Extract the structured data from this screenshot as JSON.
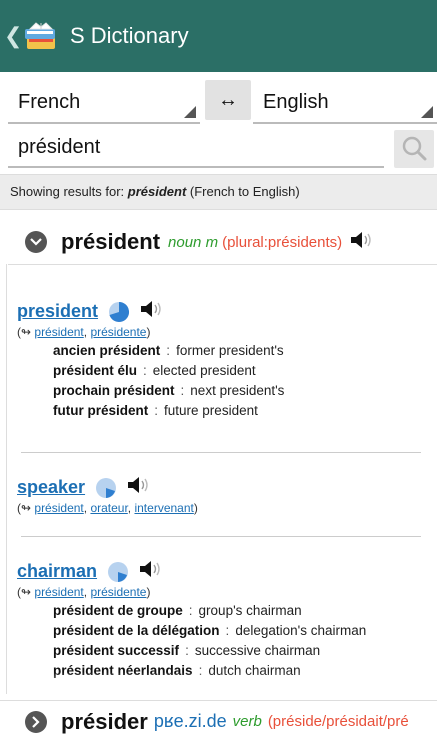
{
  "app": {
    "title": "S Dictionary",
    "back_glyph": "❮"
  },
  "languages": {
    "from": "French",
    "to": "English",
    "swap_glyph": "↔"
  },
  "search": {
    "value": "président",
    "placeholder": ""
  },
  "results_bar": {
    "prefix": "Showing results for: ",
    "term": "président",
    "suffix": " (French to English)"
  },
  "entry": {
    "headword": "président",
    "pos": "noun m",
    "plural": "(plural:présidents)",
    "translations": [
      {
        "word": "president",
        "synonyms_prefix": "(↬ ",
        "synonyms": [
          "président",
          "présidente"
        ],
        "synonyms_suffix": ")",
        "frequency": 0.6,
        "examples": [
          {
            "fr": "ancien président",
            "en": "former president's"
          },
          {
            "fr": "président élu",
            "en": "elected president"
          },
          {
            "fr": "prochain président",
            "en": "next president's"
          },
          {
            "fr": "futur président",
            "en": "future president"
          }
        ]
      },
      {
        "word": "speaker",
        "synonyms_prefix": "(↬ ",
        "synonyms": [
          "président",
          "orateur",
          "intervenant"
        ],
        "synonyms_suffix": ")",
        "frequency": 0.3,
        "examples": []
      },
      {
        "word": "chairman",
        "synonyms_prefix": "(↬ ",
        "synonyms": [
          "président",
          "présidente"
        ],
        "synonyms_suffix": ")",
        "frequency": 0.3,
        "examples": [
          {
            "fr": "président de groupe",
            "en": "group's chairman"
          },
          {
            "fr": "président de la délégation",
            "en": "delegation's chairman"
          },
          {
            "fr": "président successif",
            "en": "successive chairman"
          },
          {
            "fr": "président néerlandais",
            "en": "dutch chairman"
          }
        ]
      }
    ]
  },
  "next_entry": {
    "headword": "présider",
    "pronunciation": "pʁe.zi.de",
    "pos": "verb",
    "forms": "(préside/présidait/pré"
  },
  "colors": {
    "appbar": "#2b6f66",
    "link": "#1c6fb4",
    "pos": "#2e9c2e",
    "plural": "#e8503a",
    "freq": "#2f7fd0"
  },
  "icons": {
    "back": "chevron-left-icon",
    "logo": "book-logo-icon",
    "search": "search-icon",
    "expand": "chevron-down-icon",
    "collapsed": "chevron-right-icon",
    "speaker": "speaker-icon",
    "frequency": "frequency-pie-icon"
  }
}
